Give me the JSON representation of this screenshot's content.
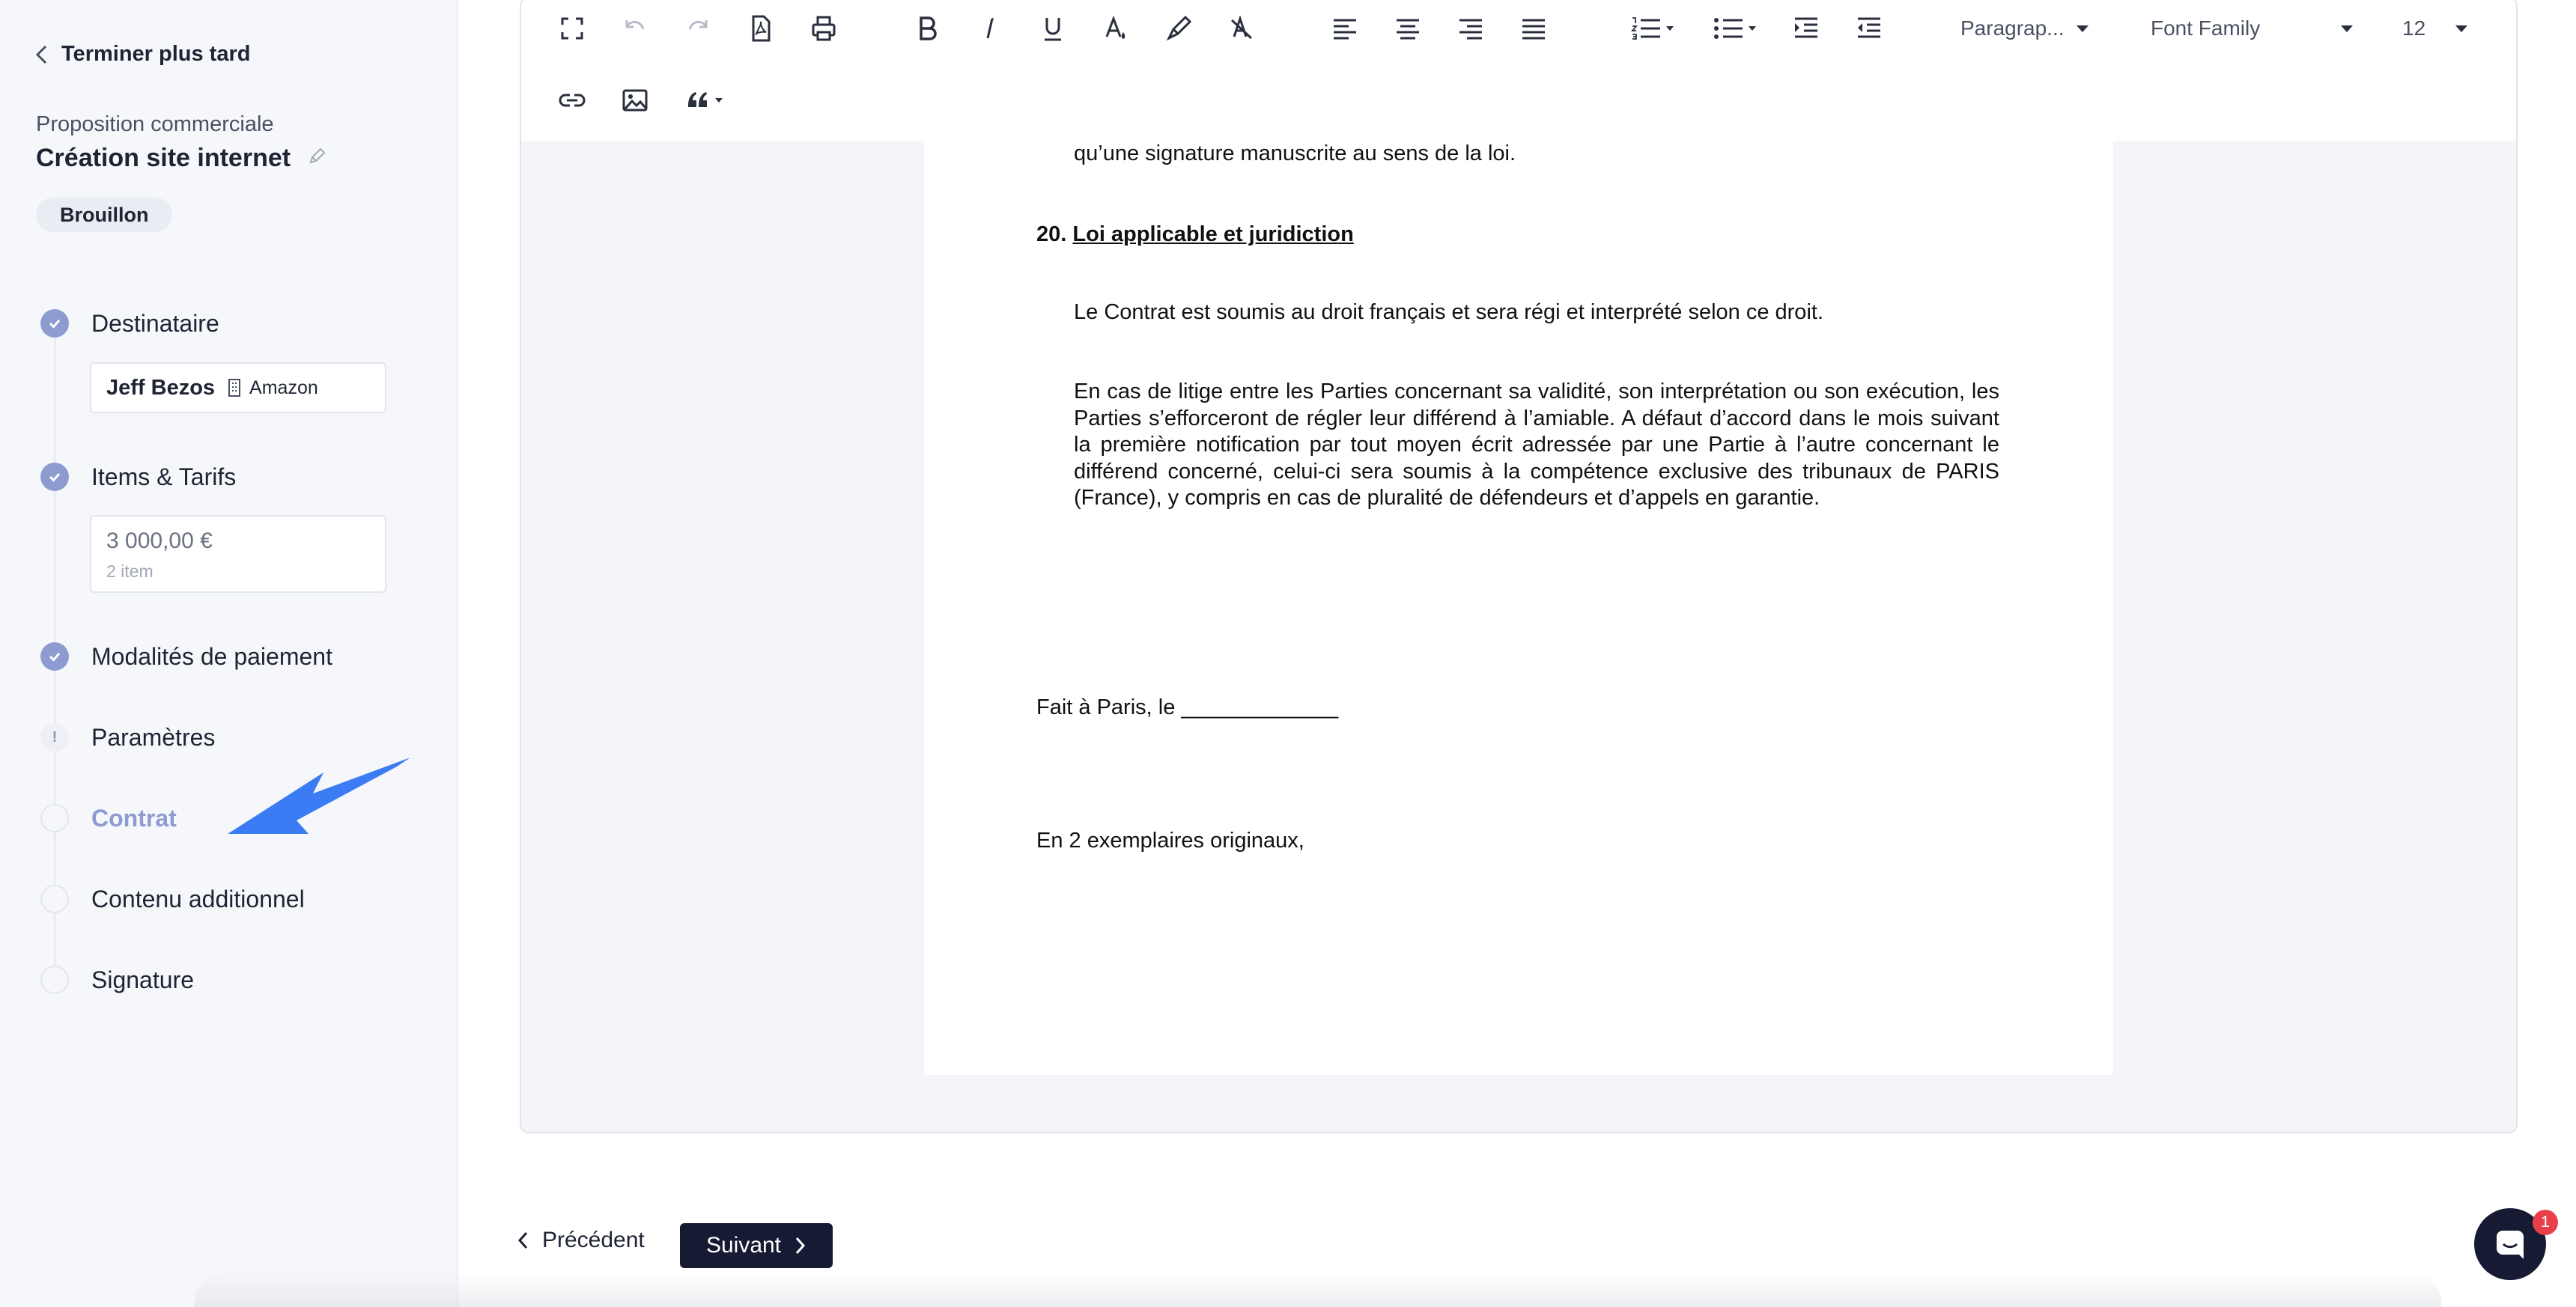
{
  "sidebar": {
    "back_label": "Terminer plus tard",
    "doc_type": "Proposition commerciale",
    "doc_title": "Création site internet",
    "status_badge": "Brouillon",
    "steps": [
      {
        "label": "Destinataire",
        "state": "done"
      },
      {
        "label": "Items & Tarifs",
        "state": "done"
      },
      {
        "label": "Modalités de paiement",
        "state": "done"
      },
      {
        "label": "Paramètres",
        "state": "warning",
        "marker": "!"
      },
      {
        "label": "Contrat",
        "state": "active"
      },
      {
        "label": "Contenu additionnel",
        "state": "pending"
      },
      {
        "label": "Signature",
        "state": "pending"
      }
    ],
    "recipient": {
      "name": "Jeff Bezos",
      "company": "Amazon"
    },
    "pricing": {
      "total": "3 000,00 €",
      "items": "2 item"
    }
  },
  "toolbar": {
    "row1": [
      "fullscreen-icon",
      "undo-icon",
      "redo-icon",
      "pdf-icon",
      "print-icon",
      "bold-icon",
      "italic-icon",
      "underline-icon",
      "text-color-icon",
      "highlight-icon",
      "clear-format-icon",
      "align-left-icon",
      "align-center-icon",
      "align-right-icon",
      "align-justify-icon",
      "ordered-list-icon",
      "bullet-list-icon",
      "indent-icon",
      "outdent-icon"
    ],
    "row2": [
      "link-icon",
      "image-icon",
      "blockquote-icon"
    ],
    "paragraph_select": "Paragrap...",
    "font_family_select": "Font Family",
    "font_size_select": "12"
  },
  "document": {
    "cut_line": "qu’une signature manuscrite au sens de la loi.",
    "section_number": "20.",
    "section_title": "Loi applicable et juridiction",
    "para1": "Le Contrat est soumis au droit français et sera régi et interprété selon ce droit.",
    "para2": "En cas de litige entre les Parties concernant sa validité, son interprétation ou son exécution, les Parties s’efforceront de régler leur différend à l’amiable. A défaut d’accord dans le mois suivant la première notification par tout moyen écrit adressée par une Partie à l’autre concernant le différend concerné, celui-ci sera soumis à la compétence exclusive des tribunaux de  PARIS (France), y compris en cas de pluralité de défendeurs et d’appels en garantie.",
    "place_date": "Fait à Paris, le _____________",
    "copies": "En 2 exemplaires originaux,"
  },
  "footer": {
    "prev_label": "Précédent",
    "next_label": "Suivant"
  },
  "chat": {
    "badge_count": "1"
  },
  "colors": {
    "accent": "#8e9bd0",
    "primary_dark": "#161b33",
    "annotation_arrow": "#3b7cf5",
    "notification": "#e8404a"
  }
}
